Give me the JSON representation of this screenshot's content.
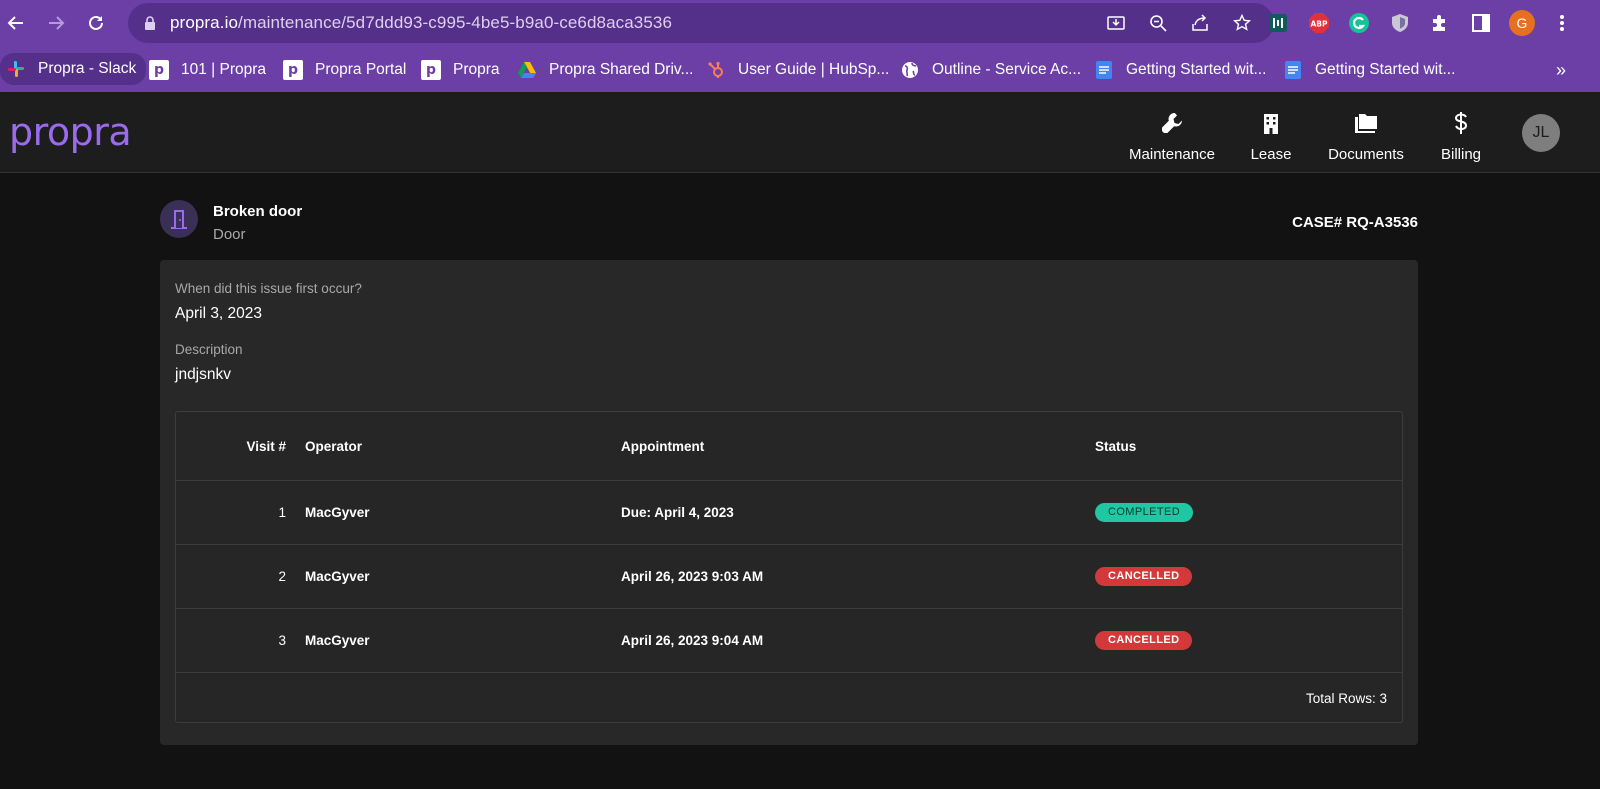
{
  "browser": {
    "url_host": "propra.io",
    "url_path": "/maintenance/5d7ddd93-c995-4be5-b9a0-ce6d8aca3536",
    "bookmarks": [
      {
        "label": "Propra - Slack",
        "icon": "slack-icon"
      },
      {
        "label": "101 | Propra",
        "icon": "propra-p-icon"
      },
      {
        "label": "Propra Portal",
        "icon": "propra-p-icon"
      },
      {
        "label": "Propra",
        "icon": "propra-p-icon"
      },
      {
        "label": "Propra Shared Driv...",
        "icon": "google-drive-icon"
      },
      {
        "label": "User Guide | HubSp...",
        "icon": "hubspot-icon"
      },
      {
        "label": "Outline - Service Ac...",
        "icon": "globe-icon"
      },
      {
        "label": "Getting Started wit...",
        "icon": "google-docs-icon"
      },
      {
        "label": "Getting Started wit...",
        "icon": "google-docs-icon"
      }
    ],
    "overflow": "»",
    "profile_initial": "G",
    "ext_abp": "ABP"
  },
  "app": {
    "logo": "propra",
    "nav": [
      {
        "label": "Maintenance",
        "icon": "wrench-icon"
      },
      {
        "label": "Lease",
        "icon": "building-icon"
      },
      {
        "label": "Documents",
        "icon": "folder-icon"
      },
      {
        "label": "Billing",
        "icon": "dollar-icon"
      }
    ],
    "avatar_initials": "JL"
  },
  "issue": {
    "title": "Broken door",
    "category": "Door",
    "case_number": "CASE# RQ-A3536",
    "first_occur_label": "When did this issue first occur?",
    "first_occur_value": "April 3, 2023",
    "description_label": "Description",
    "description_value": "jndjsnkv"
  },
  "visits": {
    "headers": {
      "visit": "Visit #",
      "operator": "Operator",
      "appointment": "Appointment",
      "status": "Status"
    },
    "rows": [
      {
        "visit": "1",
        "operator": "MacGyver",
        "appointment": "Due: April 4, 2023",
        "status": "COMPLETED"
      },
      {
        "visit": "2",
        "operator": "MacGyver",
        "appointment": "April 26, 2023 9:03 AM",
        "status": "CANCELLED"
      },
      {
        "visit": "3",
        "operator": "MacGyver",
        "appointment": "April 26, 2023 9:04 AM",
        "status": "CANCELLED"
      }
    ],
    "footer": "Total Rows: 3"
  },
  "colors": {
    "browser_purple": "#6b3fa6",
    "brand_purple": "#9a6bea",
    "completed": "#1fc7a2",
    "cancelled": "#d3393b"
  }
}
